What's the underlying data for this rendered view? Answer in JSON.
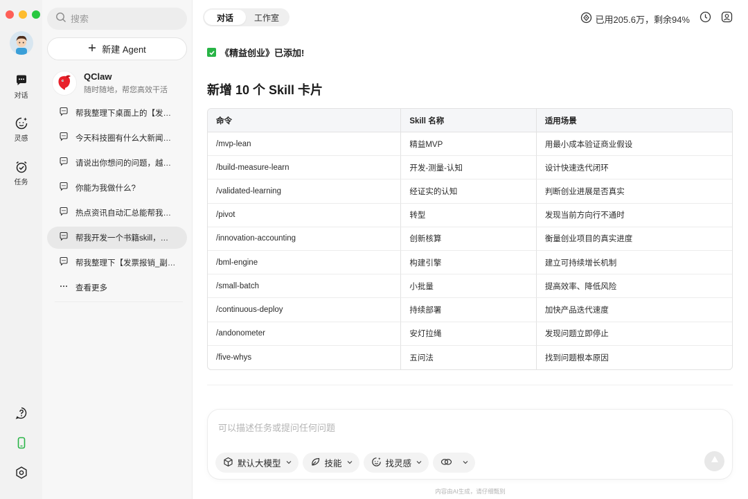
{
  "sidebar": {
    "search_placeholder": "搜索",
    "new_agent_label": "新建 Agent",
    "agent": {
      "name": "QClaw",
      "subtitle": "随时随地，帮您高效干活"
    },
    "chats": [
      {
        "text": "帮我整理下桌面上的【发票报销】文件"
      },
      {
        "text": "今天科技圈有什么大新闻，帮我汇总"
      },
      {
        "text": "请说出你想问的问题，越具体越好"
      },
      {
        "text": "你能为我做什么?"
      },
      {
        "text": "热点资讯自动汇总能帮我做什么"
      },
      {
        "text": "帮我开发一个书籍skill，能够管理"
      },
      {
        "text": "帮我整理下【发票报销_副本】文件夹"
      }
    ],
    "see_more": "查看更多"
  },
  "rail": {
    "items": [
      {
        "label": "对话"
      },
      {
        "label": "灵感"
      },
      {
        "label": "任务"
      }
    ]
  },
  "header": {
    "tabs": [
      {
        "label": "对话"
      },
      {
        "label": "工作室"
      }
    ],
    "usage": "已用205.6万，剩余94%"
  },
  "content": {
    "status": "《精益创业》已添加!",
    "heading": "新增 10 个 Skill 卡片",
    "table": {
      "headers": [
        "命令",
        "Skill 名称",
        "适用场景"
      ],
      "rows": [
        [
          "/mvp-lean",
          "精益MVP",
          "用最小成本验证商业假设"
        ],
        [
          "/build-measure-learn",
          "开发-测量-认知",
          "设计快速迭代闭环"
        ],
        [
          "/validated-learning",
          "经证实的认知",
          "判断创业进展是否真实"
        ],
        [
          "/pivot",
          "转型",
          "发现当前方向行不通时"
        ],
        [
          "/innovation-accounting",
          "创新核算",
          "衡量创业项目的真实进度"
        ],
        [
          "/bml-engine",
          "构建引擎",
          "建立可持续增长机制"
        ],
        [
          "/small-batch",
          "小批量",
          "提高效率、降低风险"
        ],
        [
          "/continuous-deploy",
          "持续部署",
          "加快产品迭代速度"
        ],
        [
          "/andonometer",
          "安灯拉绳",
          "发现问题立即停止"
        ],
        [
          "/five-whys",
          "五问法",
          "找到问题根本原因"
        ]
      ]
    }
  },
  "composer": {
    "placeholder": "可以描述任务或提问任何问题",
    "model_label": "默认大模型",
    "skills_label": "技能",
    "inspire_label": "找灵感"
  },
  "footer": {
    "note": "内容由AI生成，请仔细甄别"
  },
  "colors": {
    "accent_green": "#28b446",
    "window_red": "#fe5f57",
    "window_yellow": "#febc2e",
    "window_green": "#28c840"
  }
}
